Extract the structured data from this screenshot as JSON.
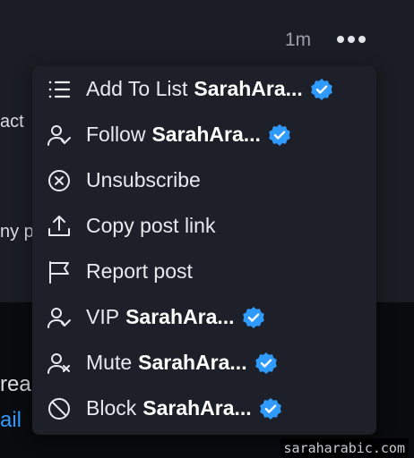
{
  "post": {
    "time": "1m",
    "fragments": [
      "act",
      "ny p",
      "rea",
      "ail"
    ]
  },
  "menu": {
    "items": [
      {
        "label": "Add To List",
        "name": "SarahAra...",
        "icon": "list-icon",
        "verified": true
      },
      {
        "label": "Follow",
        "name": "SarahAra...",
        "icon": "user-check-icon",
        "verified": true
      },
      {
        "label": "Unsubscribe",
        "name": "",
        "icon": "circle-x-icon",
        "verified": false
      },
      {
        "label": "Copy post link",
        "name": "",
        "icon": "share-upload-icon",
        "verified": false
      },
      {
        "label": "Report post",
        "name": "",
        "icon": "flag-icon",
        "verified": false
      },
      {
        "label": "VIP",
        "name": "SarahAra...",
        "icon": "user-check-icon",
        "verified": true
      },
      {
        "label": "Mute",
        "name": "SarahAra...",
        "icon": "user-x-icon",
        "verified": true
      },
      {
        "label": "Block",
        "name": "SarahAra...",
        "icon": "ban-icon",
        "verified": true
      }
    ]
  },
  "watermark": "saraharabic.com",
  "colors": {
    "badge": "#2f9bff",
    "menu_bg": "#1d2028"
  }
}
